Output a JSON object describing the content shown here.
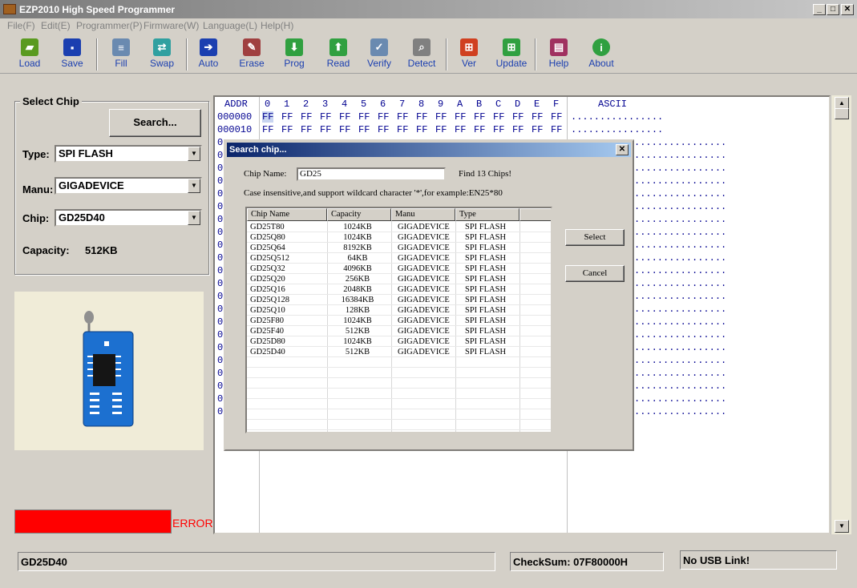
{
  "window": {
    "title": "EZP2010 High Speed Programmer",
    "min": "_",
    "max": "□",
    "close": "✕"
  },
  "menu": [
    "File(F)",
    "Edit(E)",
    "Programmer(P)",
    "Firmware(W)",
    "Language(L)",
    "Help(H)"
  ],
  "toolbar": {
    "load": "Load",
    "save": "Save",
    "fill": "Fill",
    "swap": "Swap",
    "auto": "Auto",
    "erase": "Erase",
    "prog": "Prog",
    "read": "Read",
    "verify": "Verify",
    "detect": "Detect",
    "ver": "Ver",
    "update": "Update",
    "help": "Help",
    "about": "About"
  },
  "select_chip": {
    "title": "Select Chip",
    "search_button": "Search...",
    "type_label": "Type:",
    "type_value": "SPI FLASH",
    "manu_label": "Manu:",
    "manu_value": "GIGADEVICE",
    "chip_label": "Chip:",
    "chip_value": "GD25D40",
    "capacity_label": "Capacity:",
    "capacity_value": "512KB"
  },
  "error": {
    "text": "ERROR",
    "color": "#ff0000"
  },
  "hex": {
    "addr_header": "ADDR",
    "columns": [
      "0",
      "1",
      "2",
      "3",
      "4",
      "5",
      "6",
      "7",
      "8",
      "9",
      "A",
      "B",
      "C",
      "D",
      "E",
      "F"
    ],
    "ascii_header": "ASCII",
    "row1_addr": "000000",
    "row2_addr": "000010",
    "byte": "FF",
    "ascii_dots": "................",
    "row_prefix": "0"
  },
  "status": {
    "chip": "GD25D40",
    "checksum": "CheckSum: 07F80000H",
    "usb": "No USB Link!"
  },
  "dialog": {
    "title": "Search chip...",
    "close": "✕",
    "chip_name_label": "Chip Name:",
    "chip_name_value": "GD25",
    "found": "Find 13 Chips!",
    "hint": "Case insensitive,and support wildcard character '*',for example:EN25*80",
    "headers": [
      "Chip Name",
      "Capacity",
      "Manu",
      "Type"
    ],
    "select_button": "Select",
    "cancel_button": "Cancel",
    "rows": [
      [
        "GD25T80",
        "1024KB",
        "GIGADEVICE",
        "SPI FLASH"
      ],
      [
        "GD25Q80",
        "1024KB",
        "GIGADEVICE",
        "SPI FLASH"
      ],
      [
        "GD25Q64",
        "8192KB",
        "GIGADEVICE",
        "SPI FLASH"
      ],
      [
        "GD25Q512",
        "64KB",
        "GIGADEVICE",
        "SPI FLASH"
      ],
      [
        "GD25Q32",
        "4096KB",
        "GIGADEVICE",
        "SPI FLASH"
      ],
      [
        "GD25Q20",
        "256KB",
        "GIGADEVICE",
        "SPI FLASH"
      ],
      [
        "GD25Q16",
        "2048KB",
        "GIGADEVICE",
        "SPI FLASH"
      ],
      [
        "GD25Q128",
        "16384KB",
        "GIGADEVICE",
        "SPI FLASH"
      ],
      [
        "GD25Q10",
        "128KB",
        "GIGADEVICE",
        "SPI FLASH"
      ],
      [
        "GD25F80",
        "1024KB",
        "GIGADEVICE",
        "SPI FLASH"
      ],
      [
        "GD25F40",
        "512KB",
        "GIGADEVICE",
        "SPI FLASH"
      ],
      [
        "GD25D80",
        "1024KB",
        "GIGADEVICE",
        "SPI FLASH"
      ],
      [
        "GD25D40",
        "512KB",
        "GIGADEVICE",
        "SPI FLASH"
      ]
    ]
  }
}
